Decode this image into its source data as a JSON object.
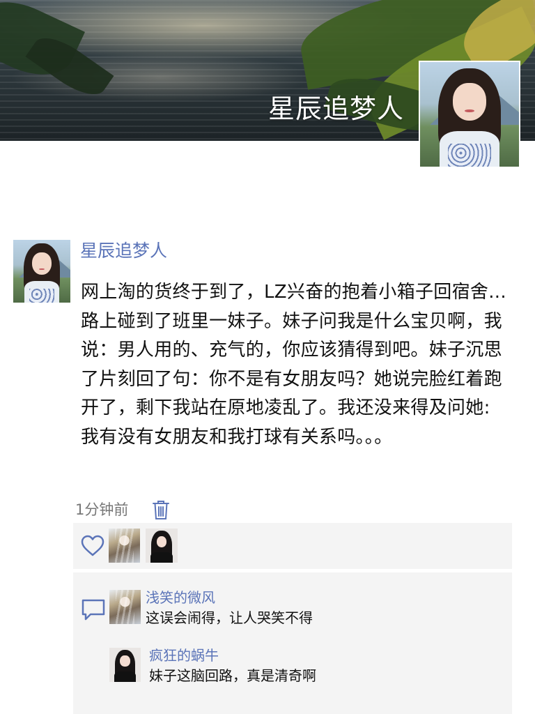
{
  "cover": {
    "title": "星辰追梦人"
  },
  "post": {
    "author": "星辰追梦人",
    "content": "网上淘的货终于到了，LZ兴奋的抱着小箱子回宿舍...路上碰到了班里一妹子。妹子问我是什么宝贝啊，我说：男人用的、充气的，你应该猜得到吧。妹子沉思了片刻回了句：你不是有女朋友吗？她说完脸红着跑开了，剩下我站在原地凌乱了。我还没来得及问她:我有没有女朋友和我打球有关系吗。。。",
    "time": "1分钟前"
  },
  "likes": {
    "icon": "heart-icon",
    "avatars": [
      "fantasy-avatar",
      "dark-hair-avatar"
    ]
  },
  "comments": [
    {
      "name": "浅笑的微风",
      "text": "这误会闹得，让人哭笑不得",
      "avatar": "fantasy-avatar"
    },
    {
      "name": "疯狂的蜗牛",
      "text": "妹子这脑回路，真是清奇啊",
      "avatar": "dark-hair-avatar"
    }
  ],
  "colors": {
    "accent": "#5b74b8",
    "panel": "#f4f4f4",
    "time": "#777777"
  }
}
